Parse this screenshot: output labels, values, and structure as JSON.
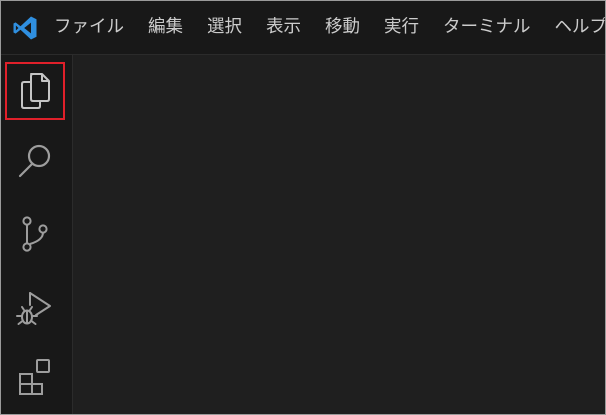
{
  "app": {
    "logo_icon": "vscode-logo-icon",
    "accent": "#2f8fe0"
  },
  "menu": {
    "items": [
      {
        "label": "ファイル"
      },
      {
        "label": "編集"
      },
      {
        "label": "選択"
      },
      {
        "label": "表示"
      },
      {
        "label": "移動"
      },
      {
        "label": "実行"
      },
      {
        "label": "ターミナル"
      },
      {
        "label": "ヘルプ"
      }
    ]
  },
  "activity_bar": {
    "items": [
      {
        "icon": "explorer-files-icon",
        "highlighted": true,
        "highlight_color": "#e0202a"
      },
      {
        "icon": "search-icon",
        "highlighted": false
      },
      {
        "icon": "source-control-icon",
        "highlighted": false
      },
      {
        "icon": "run-debug-icon",
        "highlighted": false
      },
      {
        "icon": "extensions-icon",
        "highlighted": false
      }
    ]
  }
}
